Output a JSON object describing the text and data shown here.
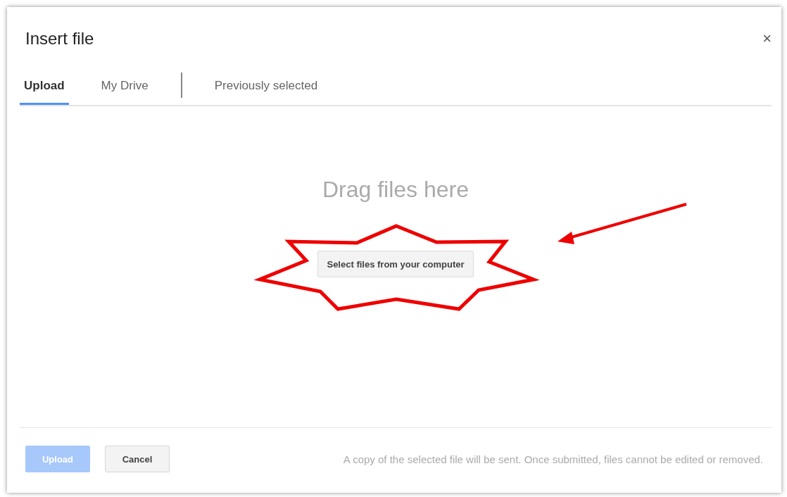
{
  "dialog": {
    "title": "Insert file",
    "close": "×"
  },
  "tabs": [
    {
      "label": "Upload",
      "selected": true
    },
    {
      "label": "My Drive",
      "selected": false
    },
    {
      "label": "Previously selected",
      "selected": false
    }
  ],
  "drop_zone": {
    "heading": "Drag files here",
    "button": "Select files from your computer"
  },
  "footer": {
    "buttons": [
      {
        "label": "Upload",
        "disabled": true
      },
      {
        "label": "Cancel",
        "disabled": false
      }
    ],
    "note": "A copy of the selected file will be sent. Once submitted, files cannot be edited or removed."
  },
  "annotations": {
    "star_outline": true,
    "arrow": true
  }
}
